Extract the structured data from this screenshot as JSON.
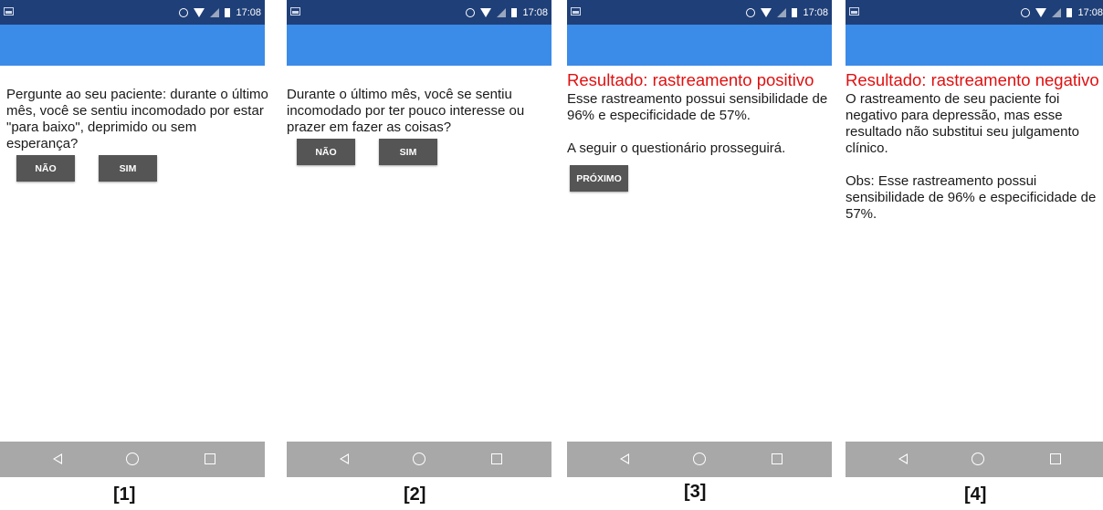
{
  "status_bar": {
    "time": "17:08"
  },
  "screens": [
    {
      "label": "[1]",
      "question": "Pergunte ao seu paciente: durante o último mês, você se sentiu incomodado por estar \"para baixo\", deprimido ou sem esperança?",
      "buttons": {
        "no": "NÃO",
        "yes": "SIM"
      }
    },
    {
      "label": "[2]",
      "question": "Durante o último mês, você se sentiu incomodado por ter pouco interesse ou prazer em fazer as coisas?",
      "buttons": {
        "no": "NÃO",
        "yes": "SIM"
      }
    },
    {
      "label": "[3]",
      "title": "Resultado: rastreamento positivo",
      "body1": "Esse rastreamento possui sensibilidade de 96% e especificidade de 57%.",
      "body2": "A seguir o questionário prosseguirá.",
      "next_button": "PRÓXIMO"
    },
    {
      "label": "[4]",
      "title": "Resultado: rastreamento negativo",
      "body1": "O rastreamento de seu paciente foi negativo para depressão, mas esse resultado não substitui seu julgamento clínico.",
      "body2": "Obs: Esse rastreamento possui sensibilidade de 96% e especificidade de 57%."
    }
  ],
  "colors": {
    "status_bar": "#1f3f78",
    "app_bar": "#3b8be8",
    "title_red": "#e01010",
    "button": "#555555",
    "nav_bar": "#a8a8a8"
  },
  "icons": [
    "image-icon",
    "alarm-icon",
    "wifi-icon",
    "signal-icon",
    "battery-icon",
    "back-icon",
    "home-icon",
    "recent-apps-icon"
  ]
}
